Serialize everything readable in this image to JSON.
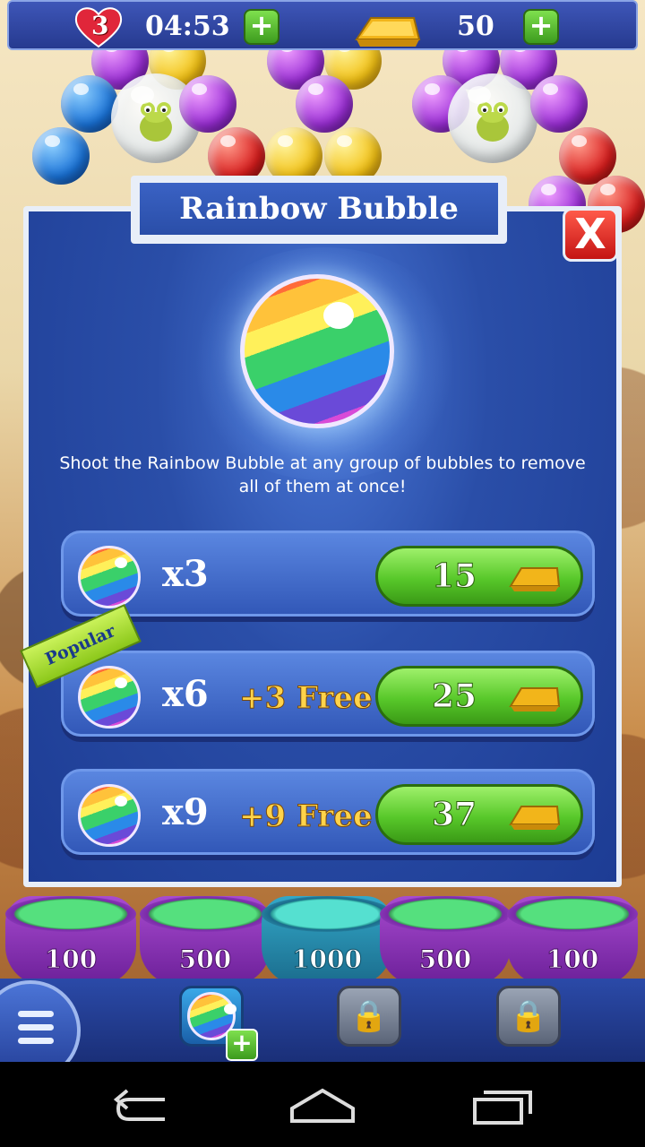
{
  "hud": {
    "lives": "3",
    "timer": "04:53",
    "gold": "50",
    "add_lives": "+",
    "add_gold": "+"
  },
  "dialog": {
    "title": "Rainbow Bubble",
    "close": "X",
    "description": "Shoot the Rainbow Bubble at any group of bubbles to remove all of them at once!",
    "popular_tag": "Popular",
    "offers": [
      {
        "qty": "x3",
        "bonus": "",
        "price": "15"
      },
      {
        "qty": "x6",
        "bonus": "+3 Free",
        "price": "25"
      },
      {
        "qty": "x9",
        "bonus": "+9 Free",
        "price": "37"
      }
    ]
  },
  "pots": [
    "100",
    "500",
    "1000",
    "500",
    "100"
  ],
  "toolbar": {
    "slot_plus": "+"
  },
  "colors": {
    "dialog_blue": "#2a4ea8",
    "buy_green": "#58c82a",
    "close_red": "#d81e1e",
    "gold": "#f2c115"
  },
  "icons": [
    "heart-icon",
    "gold-bar-icon",
    "close-icon",
    "rainbow-bubble-icon",
    "lock-icon",
    "menu-icon",
    "back-icon",
    "home-icon",
    "recents-icon"
  ]
}
